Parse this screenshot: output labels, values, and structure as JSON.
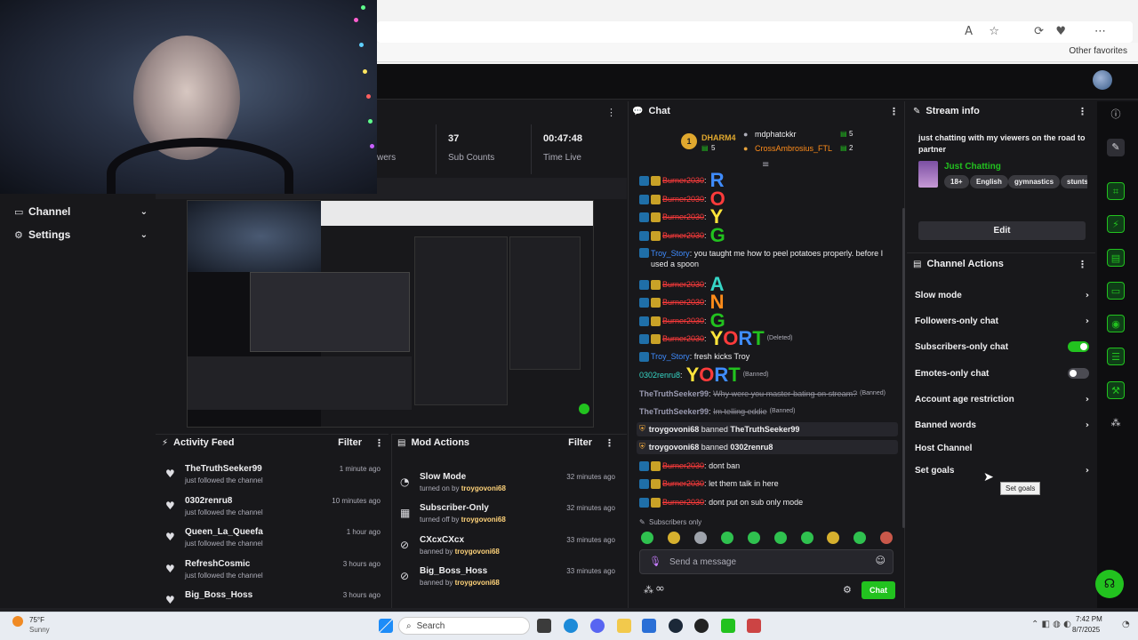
{
  "stats": [
    {
      "value": "",
      "label": "wers"
    },
    {
      "value": "37",
      "label": "Sub Counts"
    },
    {
      "value": "00:47:48",
      "label": "Time Live"
    }
  ],
  "nav": {
    "channel": "Channel",
    "settings": "Settings"
  },
  "chat": {
    "title": "Chat",
    "top_viewers": [
      {
        "rank": "1",
        "name": "DHARM4",
        "count": "5"
      },
      {
        "name": "mdphatckkr",
        "count": "5"
      },
      {
        "name": "CrossAmbrosius_FTL",
        "count": "2"
      }
    ],
    "messages": [
      {
        "user": "Burner2030",
        "letter": "R",
        "color": "#3f8cff"
      },
      {
        "user": "Burner2030",
        "letter": "O",
        "color": "#ff3b3b"
      },
      {
        "user": "Burner2030",
        "letter": "Y",
        "color": "#ffe53b"
      },
      {
        "user": "Burner2030",
        "letter": "G",
        "color": "#22c21f"
      },
      {
        "user": "Troy_Story",
        "text": "you taught me how to peel potatoes properly. before I used a spoon"
      },
      {
        "user": "Burner2030",
        "letter": "A",
        "color": "#36d6c6"
      },
      {
        "user": "Burner2030",
        "letter": "N",
        "color": "#ff8c1a"
      },
      {
        "user": "Burner2030",
        "letter": "G",
        "color": "#22c21f"
      },
      {
        "user": "Burner2030",
        "yort": "YORT",
        "note": "(Deleted)"
      },
      {
        "user": "Troy_Story",
        "text": "fresh kicks Troy"
      },
      {
        "user": "0302renru8",
        "yort": "YORT",
        "note": "(Banned)"
      },
      {
        "user": "TheTruthSeeker99",
        "text": "Why were you master-bating on stream?",
        "note": "(Banned)"
      },
      {
        "user": "TheTruthSeeker99",
        "text": "Im telling eddie",
        "note": "(Banned)"
      },
      {
        "user": "Burner2030",
        "text": "dont ban"
      },
      {
        "user": "Burner2030",
        "text": "let them talk in here"
      },
      {
        "user": "Burner2030",
        "text": "dont put on sub only mode"
      }
    ],
    "system": [
      {
        "mod": "troygovoni68",
        "action": "banned",
        "target": "TheTruthSeeker99"
      },
      {
        "mod": "troygovoni68",
        "action": "banned",
        "target": "0302renru8"
      }
    ],
    "subs_only": "Subscribers only",
    "placeholder": "Send a message",
    "infinity": "∞",
    "send_label": "Chat"
  },
  "activity": {
    "title": "Activity Feed",
    "filter": "Filter",
    "items": [
      {
        "name": "TheTruthSeeker99",
        "sub": "just followed the channel",
        "time": "1 minute ago"
      },
      {
        "name": "0302renru8",
        "sub": "just followed the channel",
        "time": "10 minutes ago"
      },
      {
        "name": "Queen_La_Queefa",
        "sub": "just followed the channel",
        "time": "1 hour ago"
      },
      {
        "name": "RefreshCosmic",
        "sub": "just followed the channel",
        "time": "3 hours ago"
      },
      {
        "name": "Big_Boss_Hoss",
        "sub": "",
        "time": "3 hours ago"
      }
    ]
  },
  "mod_actions": {
    "title": "Mod Actions",
    "filter": "Filter",
    "items": [
      {
        "name": "Slow Mode",
        "pre": "turned on by",
        "by": "troygovoni68",
        "time": "32 minutes ago"
      },
      {
        "name": "Subscriber-Only",
        "pre": "turned off by",
        "by": "troygovoni68",
        "time": "32 minutes ago"
      },
      {
        "name": "CXcxCXcx",
        "pre": "banned by",
        "by": "troygovoni68",
        "time": "33 minutes ago"
      },
      {
        "name": "Big_Boss_Hoss",
        "pre": "banned by",
        "by": "troygovoni68",
        "time": "33 minutes ago"
      }
    ]
  },
  "stream_info": {
    "title": "Stream info",
    "stream_title": "just chatting with my viewers on the road to partner",
    "category": "Just Chatting",
    "tags": [
      "18+",
      "English",
      "gymnastics",
      "stunts"
    ],
    "edit": "Edit"
  },
  "channel_actions": {
    "title": "Channel Actions",
    "items": [
      {
        "label": "Slow mode",
        "kind": "chevron"
      },
      {
        "label": "Followers-only chat",
        "kind": "chevron"
      },
      {
        "label": "Subscribers-only chat",
        "kind": "toggle-on"
      },
      {
        "label": "Emotes-only chat",
        "kind": "toggle-off"
      },
      {
        "label": "Account age restriction",
        "kind": "chevron"
      },
      {
        "label": "Banned words",
        "kind": "chevron"
      },
      {
        "label": "Host Channel",
        "kind": "none"
      },
      {
        "label": "Set goals",
        "kind": "chevron"
      }
    ],
    "tooltip": "Set goals"
  },
  "browser": {
    "favorites": "Other favorites"
  },
  "taskbar": {
    "weather_temp": "75°F",
    "weather_desc": "Sunny",
    "search": "Search",
    "time": "7:42 PM",
    "date": "8/7/2025"
  },
  "colors": {
    "accent": "#22c21f",
    "brand_dark": "#18181b"
  }
}
